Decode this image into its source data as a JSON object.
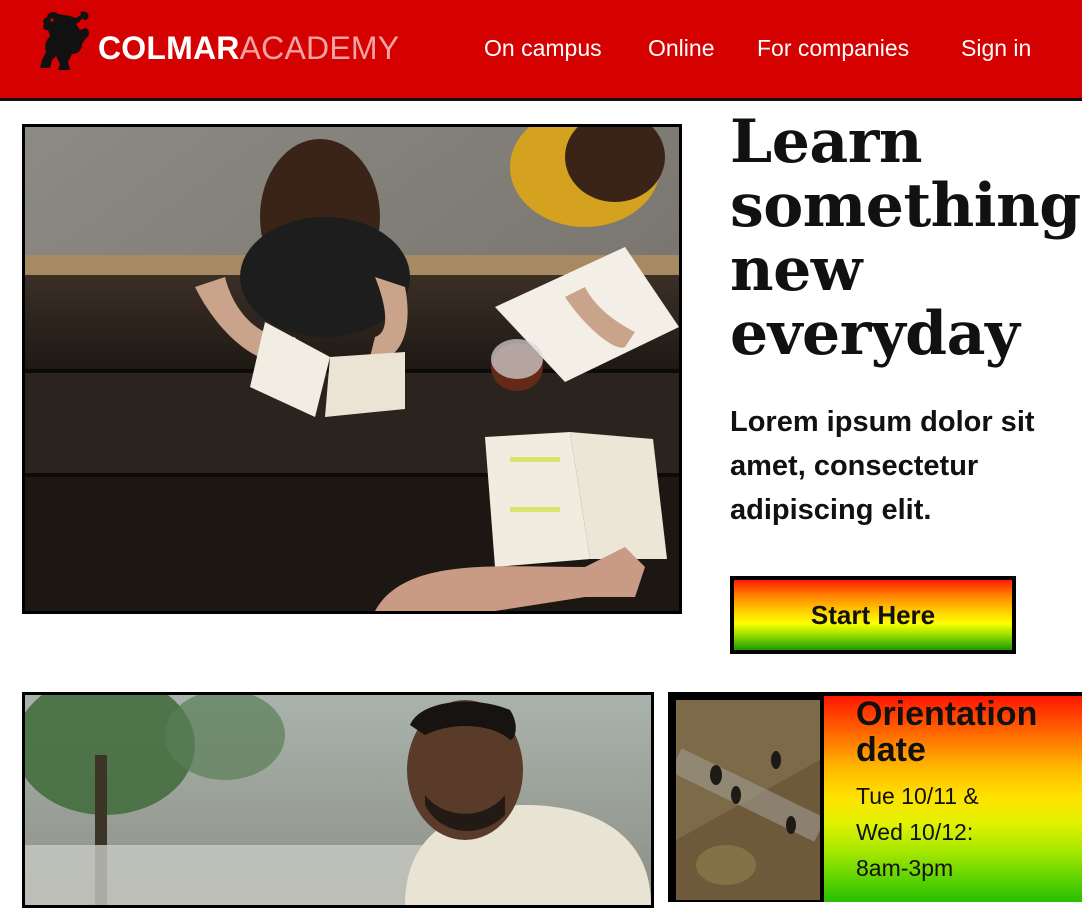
{
  "header": {
    "brand_strong": "COLMAR",
    "brand_light": "ACADEMY",
    "logo_icon": "lion-rampant-icon",
    "colors": {
      "bar": "#d50000",
      "brand_light": "#f4a3a3"
    },
    "nav": [
      {
        "label": "On campus"
      },
      {
        "label": "Online"
      },
      {
        "label": "For companies"
      },
      {
        "label": "Sign in"
      }
    ]
  },
  "hero": {
    "headline": "Learn something new everyday",
    "subtext": "Lorem ipsum dolor sit amet, consectetur adipiscing elit.",
    "cta_label": "Start Here",
    "photo": "students-reading-at-picnic-table"
  },
  "orientation": {
    "title": "Orientation date",
    "lines": [
      "Tue 10/11 &",
      "Wed 10/12:",
      "8am-3pm"
    ],
    "photo": "aerial-view-people-walking"
  },
  "bottom_photo": "smiling-man-outdoors"
}
